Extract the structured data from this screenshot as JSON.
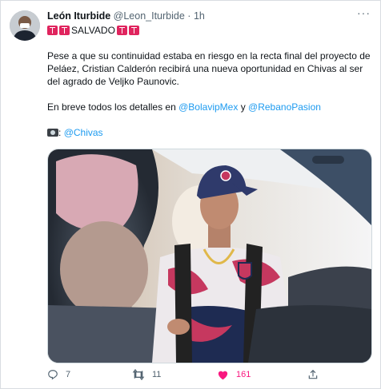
{
  "tweet": {
    "author_name": "León Iturbide",
    "author_handle": "@Leon_Iturbide",
    "separator": "·",
    "time": "1h",
    "headline": "SALVADO",
    "paragraph": "Pese a que su continuidad estaba en riesgo en la recta final del proyecto de Peláez, Cristian Calderón recibirá una nueva oportunidad en Chivas al ser del agrado de Veljko Paunovic.",
    "details_prefix": "En breve todos los detalles en",
    "mention_1": "@BolavipMex",
    "conjunction": "y",
    "mention_2": "@RebanoPasion",
    "photo_credit": "@Chivas"
  },
  "actions": {
    "reply_count": "7",
    "retweet_count": "11",
    "like_count": "161",
    "liked": true
  },
  "icons": {
    "avatar": "profile-photo",
    "more": "more-icon",
    "headline_emoji": "siren-sign-icon",
    "camera": "camera-icon",
    "reply": "reply-icon",
    "retweet": "retweet-icon",
    "like": "heart-icon",
    "share": "share-icon"
  },
  "colors": {
    "link": "#1d9bf0",
    "like_active": "#f91880",
    "muted": "#536471",
    "text": "#0f1419"
  }
}
